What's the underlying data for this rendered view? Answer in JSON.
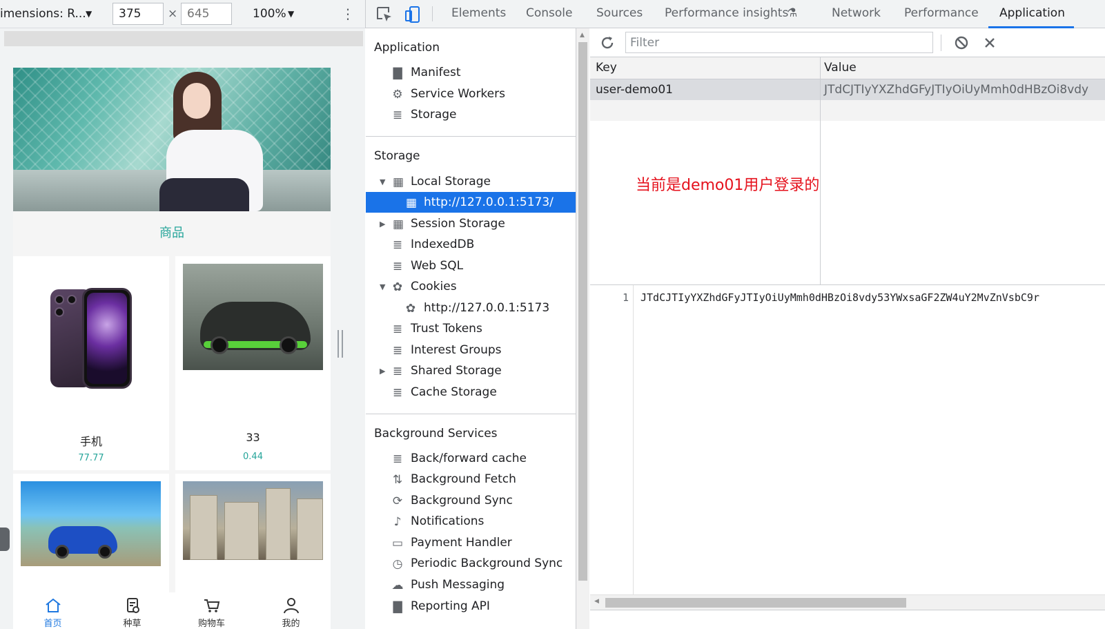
{
  "device_toolbar": {
    "dimensions_label": "imensions: R...",
    "width_value": "375",
    "height_placeholder": "645",
    "times": "×",
    "zoom": "100%",
    "caret": "▼",
    "more_icon": "more-vert-icon"
  },
  "mobile": {
    "section_title": "商品",
    "products": [
      {
        "name": "手机",
        "price": "77.77"
      },
      {
        "name": "33",
        "price": "0.44"
      }
    ],
    "tabs": [
      {
        "label": "首页",
        "icon": "home-icon",
        "active": true
      },
      {
        "label": "种草",
        "icon": "note-icon",
        "active": false
      },
      {
        "label": "购物车",
        "icon": "cart-icon",
        "active": false
      },
      {
        "label": "我的",
        "icon": "user-icon",
        "active": false
      }
    ]
  },
  "devtools": {
    "tabs": [
      "Elements",
      "Console",
      "Sources",
      "Performance insights",
      "Network",
      "Performance",
      "Application"
    ],
    "active_tab": "Application",
    "flask_icon": "⚗"
  },
  "sidebar": {
    "application_heading": "Application",
    "application_items": [
      "Manifest",
      "Service Workers",
      "Storage"
    ],
    "storage_heading": "Storage",
    "storage_items": [
      "Local Storage",
      "http://127.0.0.1:5173/",
      "Session Storage",
      "IndexedDB",
      "Web SQL",
      "Cookies",
      "http://127.0.0.1:5173",
      "Trust Tokens",
      "Interest Groups",
      "Shared Storage",
      "Cache Storage"
    ],
    "background_heading": "Background Services",
    "background_items": [
      "Back/forward cache",
      "Background Fetch",
      "Background Sync",
      "Notifications",
      "Payment Handler",
      "Periodic Background Sync",
      "Push Messaging",
      "Reporting API"
    ]
  },
  "storage_view": {
    "filter_placeholder": "Filter",
    "columns": {
      "key": "Key",
      "value": "Value"
    },
    "rows": [
      {
        "key": "user-demo01",
        "value": "JTdCJTIyYXZhdGFyJTIyOiUyMmh0dHBzOi8vdy"
      }
    ],
    "annotation": "当前是demo01用户登录的",
    "line_number": "1",
    "value_preview": "JTdCJTIyYXZhdGFyJTIyOiUyMmh0dHBzOi8vdy53YWxsaGF2ZW4uY2MvZnVsbC9r"
  },
  "colors": {
    "accent": "#1a73e8",
    "brand_teal": "#26a59a",
    "annotation_red": "#e5121d"
  }
}
